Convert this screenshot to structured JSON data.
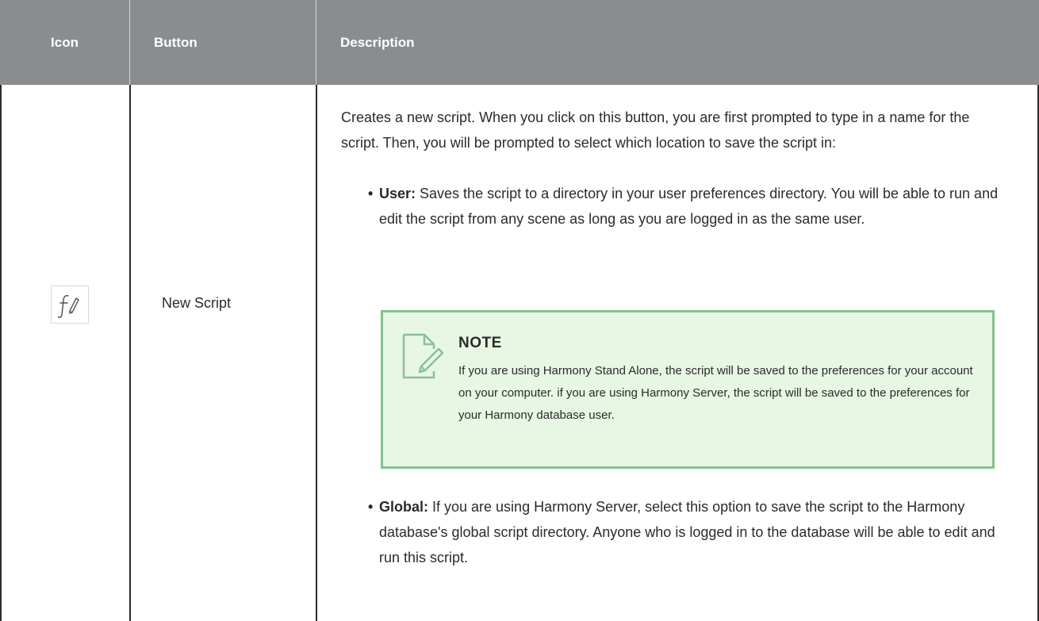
{
  "table": {
    "headers": {
      "icon": "Icon",
      "button": "Button",
      "description": "Description"
    },
    "row": {
      "icon_name": "new-script-icon",
      "icon_glyph": "f",
      "button_name": "New Script",
      "description_intro": "Creates a new script. When you click on this button, you are first prompted to type in a name for the script. Then, you will be prompted to select which location to save the script in:",
      "bullets": [
        {
          "lead": "User:",
          "text": " Saves the script to a directory in your user preferences directory. You will be able to run and edit the script from any scene as long as you are logged in as the same user."
        },
        {
          "lead": "Global:",
          "text": " If you are using Harmony Server, select this option to save the script to the Harmony database's global script directory. Anyone who is logged in to the database will be able to edit and run this script."
        }
      ],
      "note": {
        "title": "NOTE",
        "text": "If you are using Harmony Stand Alone, the script will be saved to the preferences for your account on your computer. if you are using Harmony Server, the script will be saved to the preferences for your Harmony database user."
      }
    }
  },
  "colors": {
    "header_bg": "#8a8d90",
    "header_text": "#ffffff",
    "note_bg": "#e8f6e4",
    "note_border": "#86bf8f",
    "body_text": "#2b2b2b"
  }
}
